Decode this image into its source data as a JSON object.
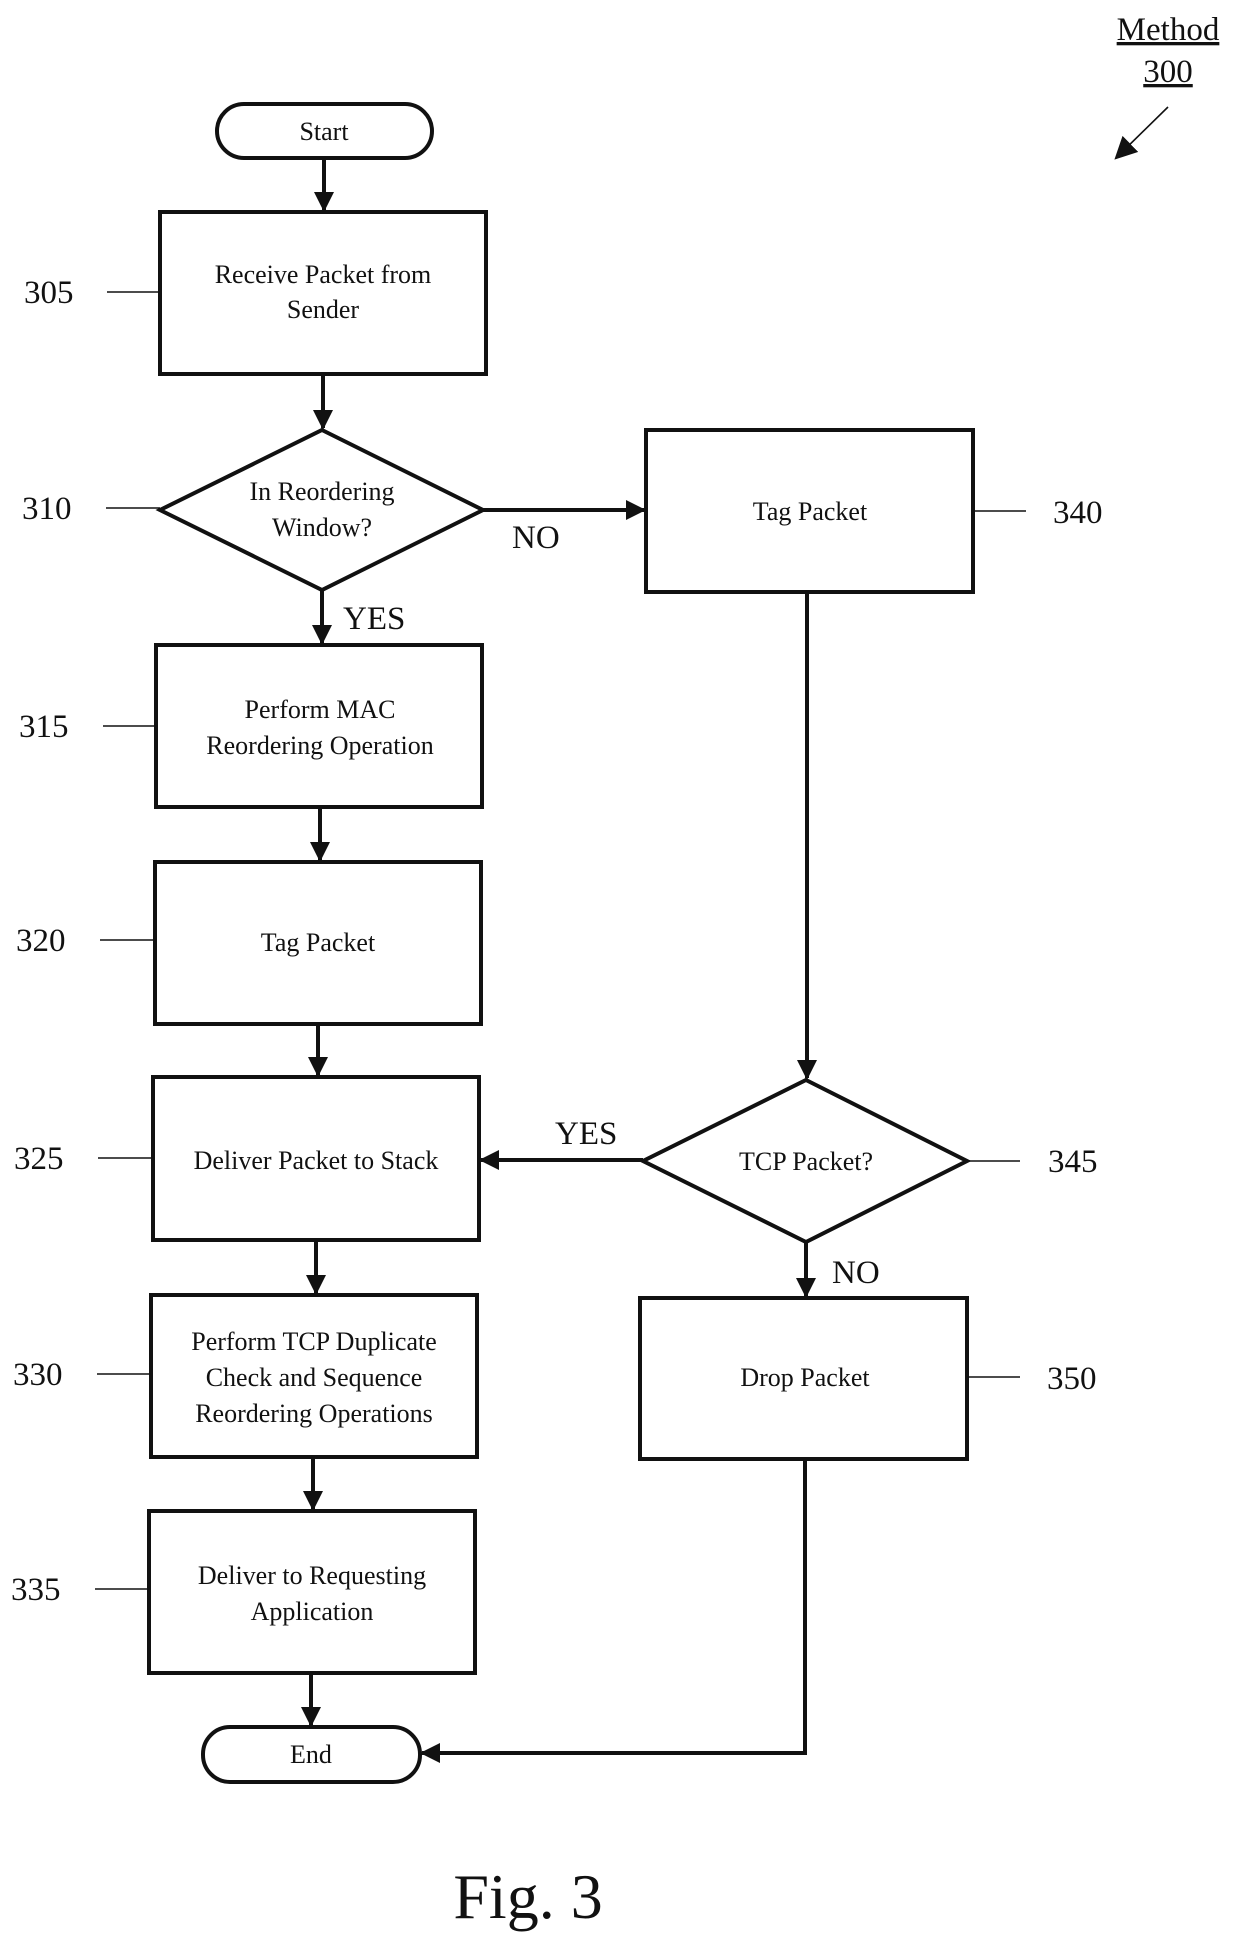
{
  "figure": {
    "caption": "Fig. 3",
    "method_label_line1": "Method",
    "method_label_line2": "300"
  },
  "nodes": {
    "start": {
      "text": "Start"
    },
    "n305": {
      "ref": "305",
      "lines": [
        "Receive Packet from",
        "Sender"
      ]
    },
    "n310": {
      "ref": "310",
      "lines": [
        "In Reordering",
        "Window?"
      ]
    },
    "n315": {
      "ref": "315",
      "lines": [
        "Perform MAC",
        "Reordering Operation"
      ]
    },
    "n320": {
      "ref": "320",
      "lines": [
        "Tag Packet"
      ]
    },
    "n325": {
      "ref": "325",
      "lines": [
        "Deliver Packet to Stack"
      ]
    },
    "n330": {
      "ref": "330",
      "lines": [
        "Perform TCP Duplicate",
        "Check and Sequence",
        "Reordering Operations"
      ]
    },
    "n335": {
      "ref": "335",
      "lines": [
        "Deliver to Requesting",
        "Application"
      ]
    },
    "n340": {
      "ref": "340",
      "lines": [
        "Tag Packet"
      ]
    },
    "n345": {
      "ref": "345",
      "lines": [
        "TCP Packet?"
      ]
    },
    "n350": {
      "ref": "350",
      "lines": [
        "Drop Packet"
      ]
    },
    "end": {
      "text": "End"
    }
  },
  "branches": {
    "n310_no": "NO",
    "n310_yes": "YES",
    "n345_yes": "YES",
    "n345_no": "NO"
  }
}
